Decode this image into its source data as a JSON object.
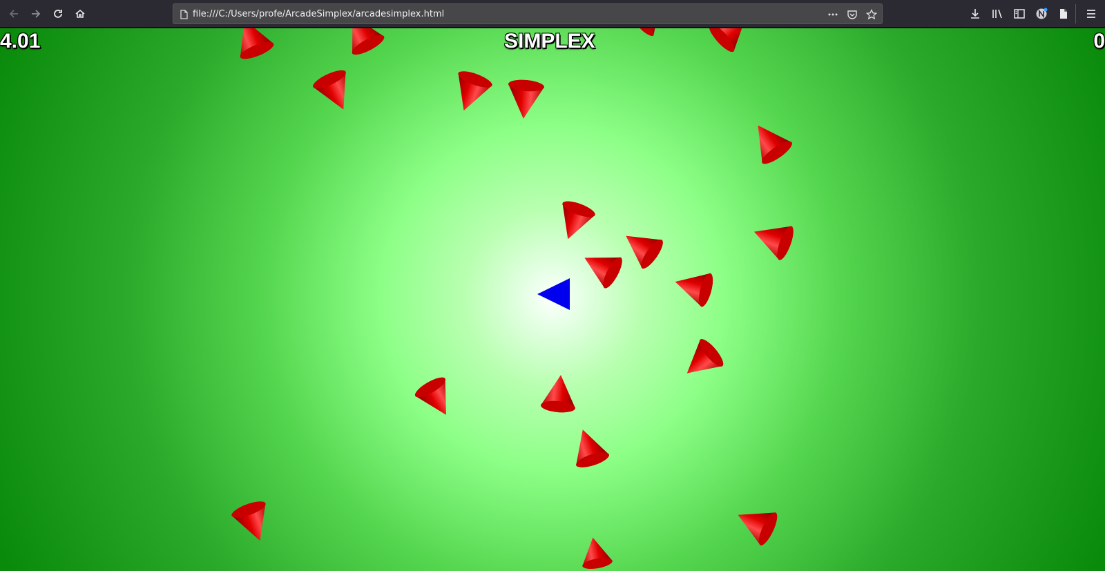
{
  "browser": {
    "url": "file:///C:/Users/profe/ArcadeSimplex/arcadesimplex.html",
    "icons": [
      "back-arrow-icon",
      "forward-arrow-icon",
      "reload-icon",
      "home-icon",
      "page-icon",
      "more-dots-icon",
      "pocket-icon",
      "bookmark-star-icon",
      "downloads-icon",
      "library-icon",
      "sidebar-icon",
      "extension-n-icon",
      "reader-icon",
      "menu-hamburger-icon"
    ]
  },
  "hud": {
    "time": "4.01",
    "title": "SIMPLEX",
    "score": "0"
  },
  "colors": {
    "player": "#0000ee",
    "enemy": "#e50000",
    "enemy_highlight": "#ff5050",
    "enemy_shade": "#900000",
    "background_center": "#ffffff",
    "background_edge": "#088808"
  }
}
